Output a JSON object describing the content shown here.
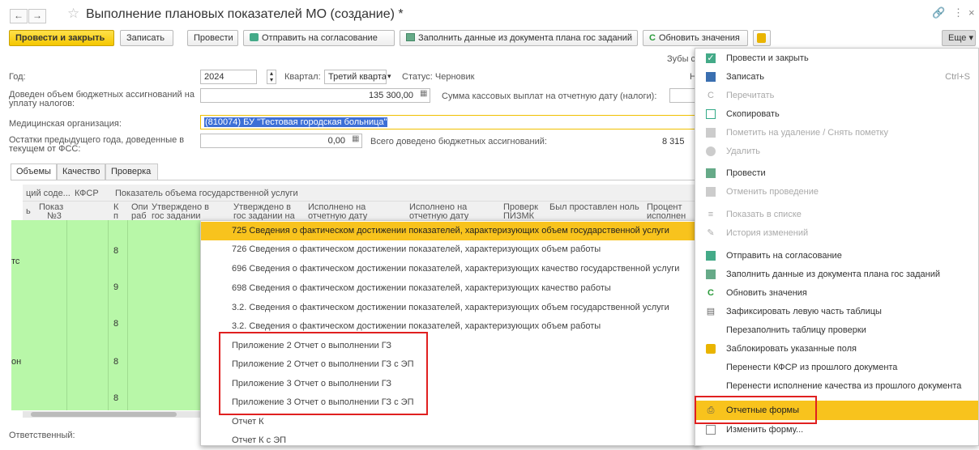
{
  "window": {
    "title": "Выполнение плановых показателей МО (создание) *"
  },
  "toolbar": {
    "post_close": "Провести и закрыть",
    "save": "Записать",
    "post": "Провести",
    "send_approval": "Отправить на согласование",
    "fill_from_plan": "Заполнить данные из документа плана гос заданий",
    "refresh": "Обновить значения",
    "more": "Еще"
  },
  "form": {
    "teeth_label": "Зубы сп",
    "year_label": "Год:",
    "year_value": "2024",
    "quarter_label": "Квартал:",
    "quarter_value": "Третий кварта",
    "status_label": "Статус: Черновик",
    "n_label": "Не",
    "budget_label_1": "Доведен объем бюджетных ассигнований на",
    "budget_label_2": "уплату налогов:",
    "budget_value": "135 300,00",
    "cash_label": "Сумма кассовых выплат на отчетную дату (налоги):",
    "org_label": "Медицинская организация:",
    "org_value": "(810074) БУ \"Тестовая городская больница\"",
    "prev_label_1": "Остатки предыдущего года, доведенные в",
    "prev_label_2": "текущем от ФСС:",
    "prev_value": "0,00",
    "total_label": "Всего доведено бюджетных ассигнований:",
    "total_value": "8 315",
    "responsible_label": "Ответственный:"
  },
  "tabs": [
    "Объемы",
    "Качество",
    "Проверка"
  ],
  "grid": {
    "h1": [
      "ций соде...",
      "КФСР",
      "Показатель объема государственной услуги"
    ],
    "h2": [
      "ь",
      "Показ",
      "№3",
      "К",
      "п",
      "Опи",
      "раб",
      "Утверждено в",
      "гос задании",
      "Утверждено в",
      "гос задании на",
      "Исполнено на",
      "отчетную дату",
      "Исполнено на",
      "отчетную дату",
      "Проверк",
      "ПИЗМК",
      "Был проставлен ноль",
      "Процент",
      "исполнен"
    ],
    "left_texts": [
      "тс",
      "он"
    ],
    "k_values": [
      "8",
      "9",
      "8",
      "8",
      "8"
    ]
  },
  "dropdown": {
    "items": [
      "725 Сведения о фактическом достижении показателей, характеризующих объем государственной услуги",
      "726 Сведения о фактическом достижении показателей, характеризующих объем работы",
      "696 Сведения о фактическом достижении показателей, характеризующих качество государственной услуги",
      "698 Сведения о фактическом достижении показателей, характеризующих качество работы",
      "3.2. Сведения о фактическом достижении показателей, характеризующих объем государственной услуги",
      "3.2. Сведения о фактическом достижении показателей, характеризующих объем работы",
      "Приложение 2 Отчет о выполнении ГЗ",
      "Приложение 2 Отчет о выполнении ГЗ с ЭП",
      "Приложение 3 Отчет о выполнении ГЗ",
      "Приложение 3 Отчет о выполнении ГЗ с ЭП",
      "Отчет К",
      "Отчет К с ЭП"
    ],
    "selected_index": 0
  },
  "menu": {
    "items": [
      {
        "label": "Провести и закрыть",
        "icon": "post-close-icon",
        "disabled": false
      },
      {
        "label": "Записать",
        "icon": "save-icon",
        "disabled": false,
        "shortcut": "Ctrl+S"
      },
      {
        "label": "Перечитать",
        "icon": "reread-icon",
        "disabled": true
      },
      {
        "label": "Скопировать",
        "icon": "copy-icon",
        "disabled": false
      },
      {
        "label": "Пометить на удаление / Снять пометку",
        "icon": "mark-delete-icon",
        "disabled": true
      },
      {
        "label": "Удалить",
        "icon": "delete-icon",
        "disabled": true
      },
      {
        "label": "Провести",
        "icon": "post-icon",
        "disabled": false
      },
      {
        "label": "Отменить проведение",
        "icon": "unpost-icon",
        "disabled": true
      },
      {
        "label": "Показать в списке",
        "icon": "list-icon",
        "disabled": true
      },
      {
        "label": "История изменений",
        "icon": "history-icon",
        "disabled": true
      },
      {
        "label": "Отправить на согласование",
        "icon": "send-approval-icon",
        "disabled": false
      },
      {
        "label": "Заполнить данные из документа плана гос заданий",
        "icon": "fill-icon",
        "disabled": false
      },
      {
        "label": "Обновить значения",
        "icon": "refresh-icon",
        "disabled": false
      },
      {
        "label": "Зафиксировать левую часть таблицы",
        "icon": "freeze-icon",
        "disabled": false
      },
      {
        "label": "Перезаполнить таблицу проверки",
        "icon": "",
        "disabled": false
      },
      {
        "label": "Заблокировать указанные поля",
        "icon": "lock-icon",
        "disabled": false
      },
      {
        "label": "Перенести КФСР из прошлого документа",
        "icon": "",
        "disabled": false
      },
      {
        "label": "Перенести исполнение качества из прошлого документа",
        "icon": "",
        "disabled": false
      },
      {
        "label": "Отчетные формы",
        "icon": "print-icon",
        "disabled": false
      },
      {
        "label": "Изменить форму...",
        "icon": "form-edit-icon",
        "disabled": false
      }
    ],
    "selected_index": 18
  },
  "colors": {
    "accent": "#f8c31d",
    "green_cell": "#b8f7a8",
    "highlight_red": "#e02020"
  }
}
